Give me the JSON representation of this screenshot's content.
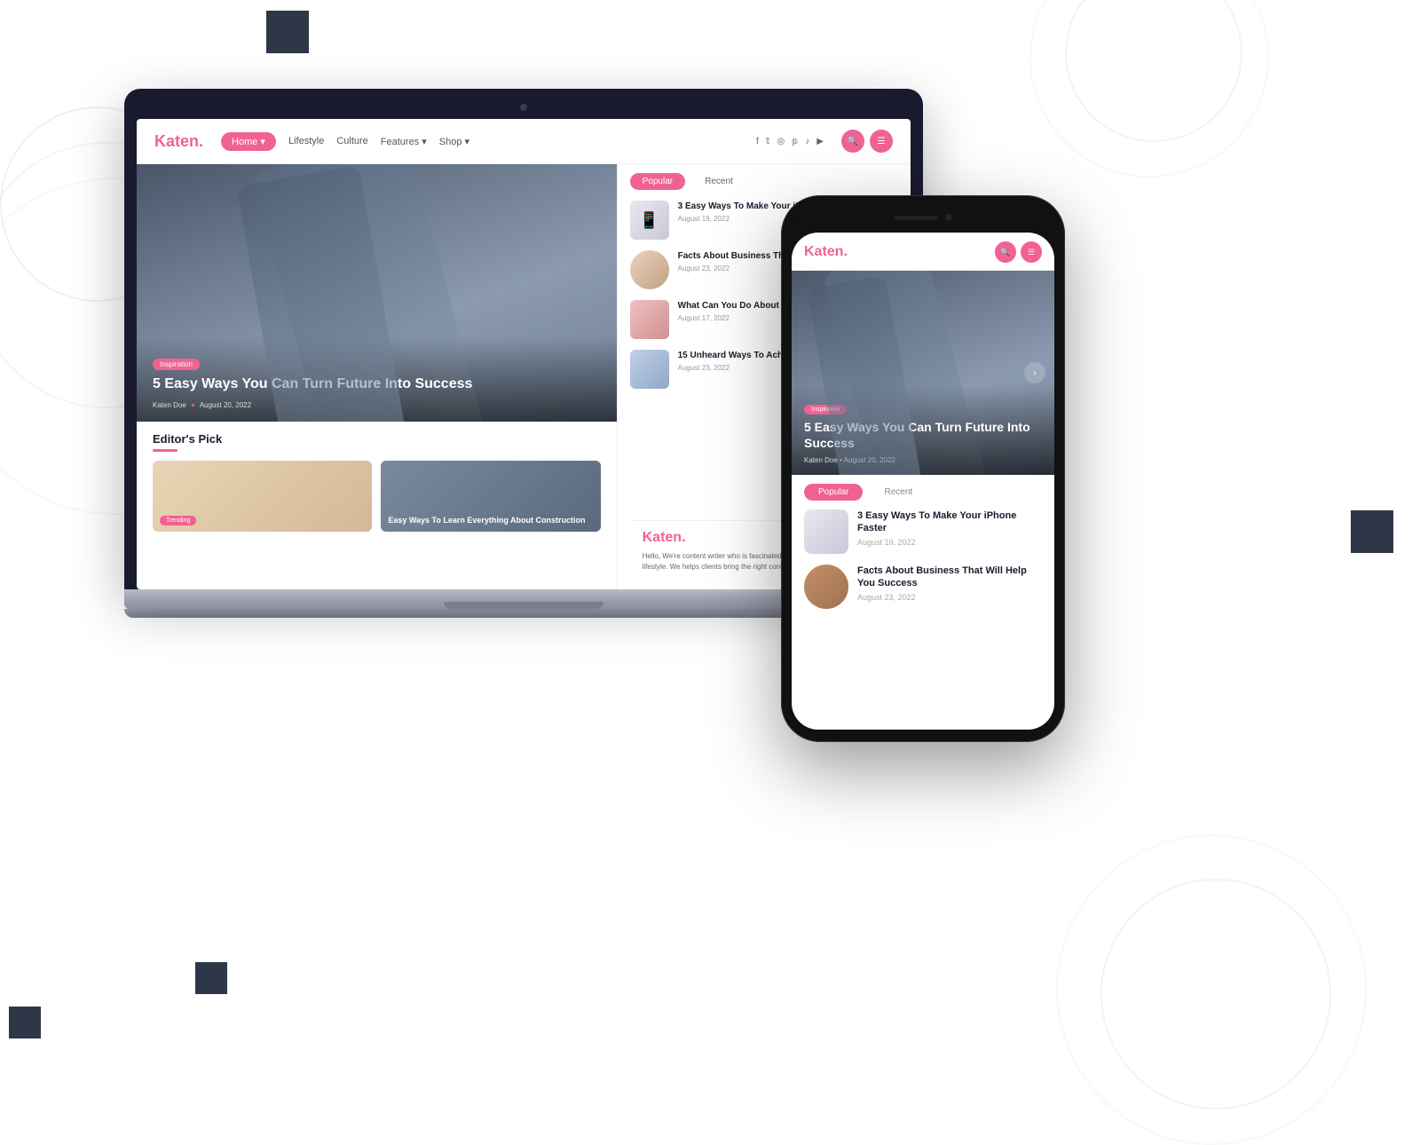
{
  "brand": {
    "name": "Katen",
    "dot": "."
  },
  "nav": {
    "items": [
      {
        "label": "Home",
        "active": true
      },
      {
        "label": "Lifestyle",
        "active": false
      },
      {
        "label": "Culture",
        "active": false
      },
      {
        "label": "Features",
        "active": false,
        "hasArrow": true
      },
      {
        "label": "Shop",
        "active": false,
        "hasArrow": true
      }
    ],
    "social_icons": [
      "f",
      "t",
      "ig",
      "p",
      "tt",
      "yt"
    ],
    "search_label": "🔍",
    "menu_label": "☰"
  },
  "hero": {
    "tag": "Inspiration",
    "title": "5 Easy Ways You Can Turn Future Into Success",
    "author": "Katen Doe",
    "date": "August 20, 2022"
  },
  "popular_tabs": {
    "active": "Popular",
    "inactive": "Recent"
  },
  "articles": [
    {
      "title": "3 Easy Ways To Make Your iPhone Faster",
      "date": "August 19, 2022",
      "thumb_type": "phone"
    },
    {
      "title": "Facts About Business That Will Help You Success",
      "date": "August 23, 2022",
      "thumb_type": "person"
    },
    {
      "title": "What Can You Do About Fashion Right Now",
      "date": "August 17, 2022",
      "thumb_type": "fashion"
    },
    {
      "title": "15 Unheard Ways To Achieve Greater Walker",
      "date": "August 23, 2022",
      "thumb_type": "walker"
    }
  ],
  "editors_pick": {
    "title": "Editor's Pick",
    "card1": {
      "badge": "Trending"
    },
    "card2": {
      "title": "Easy Ways To Learn Everything About Construction"
    }
  },
  "about": {
    "text": "Hello, We're content writer who is fascinated by content fashion, celebrity and lifestyle. We helps clients bring the right content to the right people."
  },
  "phone_articles": [
    {
      "title": "3 Easy Ways To Make Your iPhone Faster",
      "date": "August 19, 2022",
      "thumb_type": "phone"
    },
    {
      "title": "Facts About Business That Will Help You Success",
      "date": "August 23, 2022",
      "thumb_type": "person"
    }
  ],
  "colors": {
    "accent": "#f06292",
    "dark": "#1a1a2e",
    "text_secondary": "#666666"
  }
}
